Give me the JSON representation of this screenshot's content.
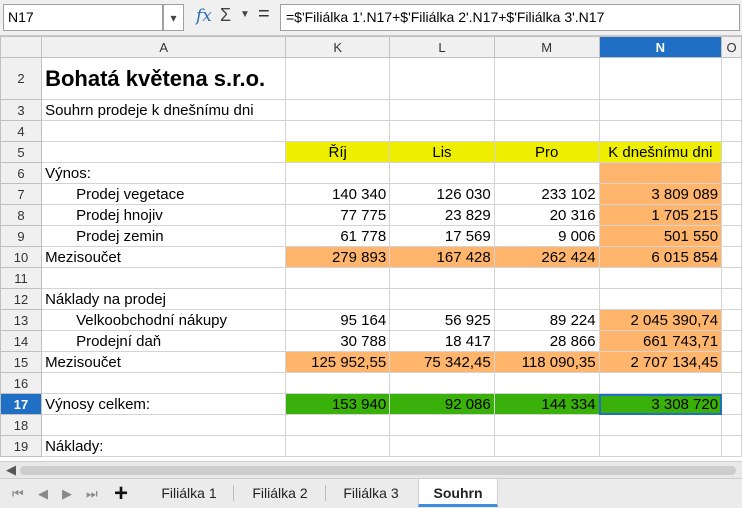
{
  "formula_bar": {
    "name_box": "N17",
    "fx_symbol": "fx",
    "sigma_symbol": "Σ",
    "equals_symbol": "=",
    "formula": "=$'Filiálka 1'.N17+$'Filiálka 2'.N17+$'Filiálka 3'.N17"
  },
  "columns": [
    "A",
    "K",
    "L",
    "M",
    "N",
    "O"
  ],
  "selected_column": "N",
  "rows": [
    {
      "n": "2",
      "a": "Bohatá květena s.r.o.",
      "k": "",
      "l": "",
      "m": "",
      "nv": ""
    },
    {
      "n": "3",
      "a": "Souhrn prodeje k dnešnímu dni",
      "k": "",
      "l": "",
      "m": "",
      "nv": ""
    },
    {
      "n": "4",
      "a": "",
      "k": "",
      "l": "",
      "m": "",
      "nv": ""
    },
    {
      "n": "5",
      "a": "",
      "k": "Říj",
      "l": "Lis",
      "m": "Pro",
      "nv": "K dnešnímu dni"
    },
    {
      "n": "6",
      "a": "Výnos:",
      "k": "",
      "l": "",
      "m": "",
      "nv": ""
    },
    {
      "n": "7",
      "a": "Prodej vegetace",
      "k": "140 340",
      "l": "126 030",
      "m": "233 102",
      "nv": "3 809 089"
    },
    {
      "n": "8",
      "a": "Prodej hnojiv",
      "k": "77 775",
      "l": "23 829",
      "m": "20 316",
      "nv": "1 705 215"
    },
    {
      "n": "9",
      "a": "Prodej zemin",
      "k": "61 778",
      "l": "17 569",
      "m": "9 006",
      "nv": "501 550"
    },
    {
      "n": "10",
      "a": "Mezisoučet",
      "k": "279 893",
      "l": "167 428",
      "m": "262 424",
      "nv": "6 015 854"
    },
    {
      "n": "11",
      "a": "",
      "k": "",
      "l": "",
      "m": "",
      "nv": ""
    },
    {
      "n": "12",
      "a": "Náklady na prodej",
      "k": "",
      "l": "",
      "m": "",
      "nv": ""
    },
    {
      "n": "13",
      "a": "Velkoobchodní nákupy",
      "k": "95 164",
      "l": "56 925",
      "m": "89 224",
      "nv": "2 045 390,74"
    },
    {
      "n": "14",
      "a": "Prodejní daň",
      "k": "30 788",
      "l": "18 417",
      "m": "28 866",
      "nv": "661 743,71"
    },
    {
      "n": "15",
      "a": "Mezisoučet",
      "k": "125 952,55",
      "l": "75 342,45",
      "m": "118 090,35",
      "nv": "2 707 134,45"
    },
    {
      "n": "16",
      "a": "",
      "k": "",
      "l": "",
      "m": "",
      "nv": ""
    },
    {
      "n": "17",
      "a": "Výnosy celkem:",
      "k": "153 940",
      "l": "92 086",
      "m": "144 334",
      "nv": "3 308 720"
    },
    {
      "n": "18",
      "a": "",
      "k": "",
      "l": "",
      "m": "",
      "nv": ""
    },
    {
      "n": "19",
      "a": "Náklady:",
      "k": "",
      "l": "",
      "m": "",
      "nv": ""
    }
  ],
  "selected_row": "17",
  "sheet_tabs": [
    "Filiálka 1",
    "Filiálka 2",
    "Filiálka 3",
    "Souhrn"
  ],
  "active_tab": "Souhrn",
  "icons": {
    "nav_first": "first-sheet-icon",
    "nav_prev": "prev-sheet-icon",
    "nav_next": "next-sheet-icon",
    "nav_last": "last-sheet-icon",
    "add": "add-sheet-icon"
  },
  "colors": {
    "selection": "#1f6fc4",
    "header_yellow": "#eeee00",
    "highlight_orange": "#ffb66c",
    "total_green": "#3ab10a"
  }
}
